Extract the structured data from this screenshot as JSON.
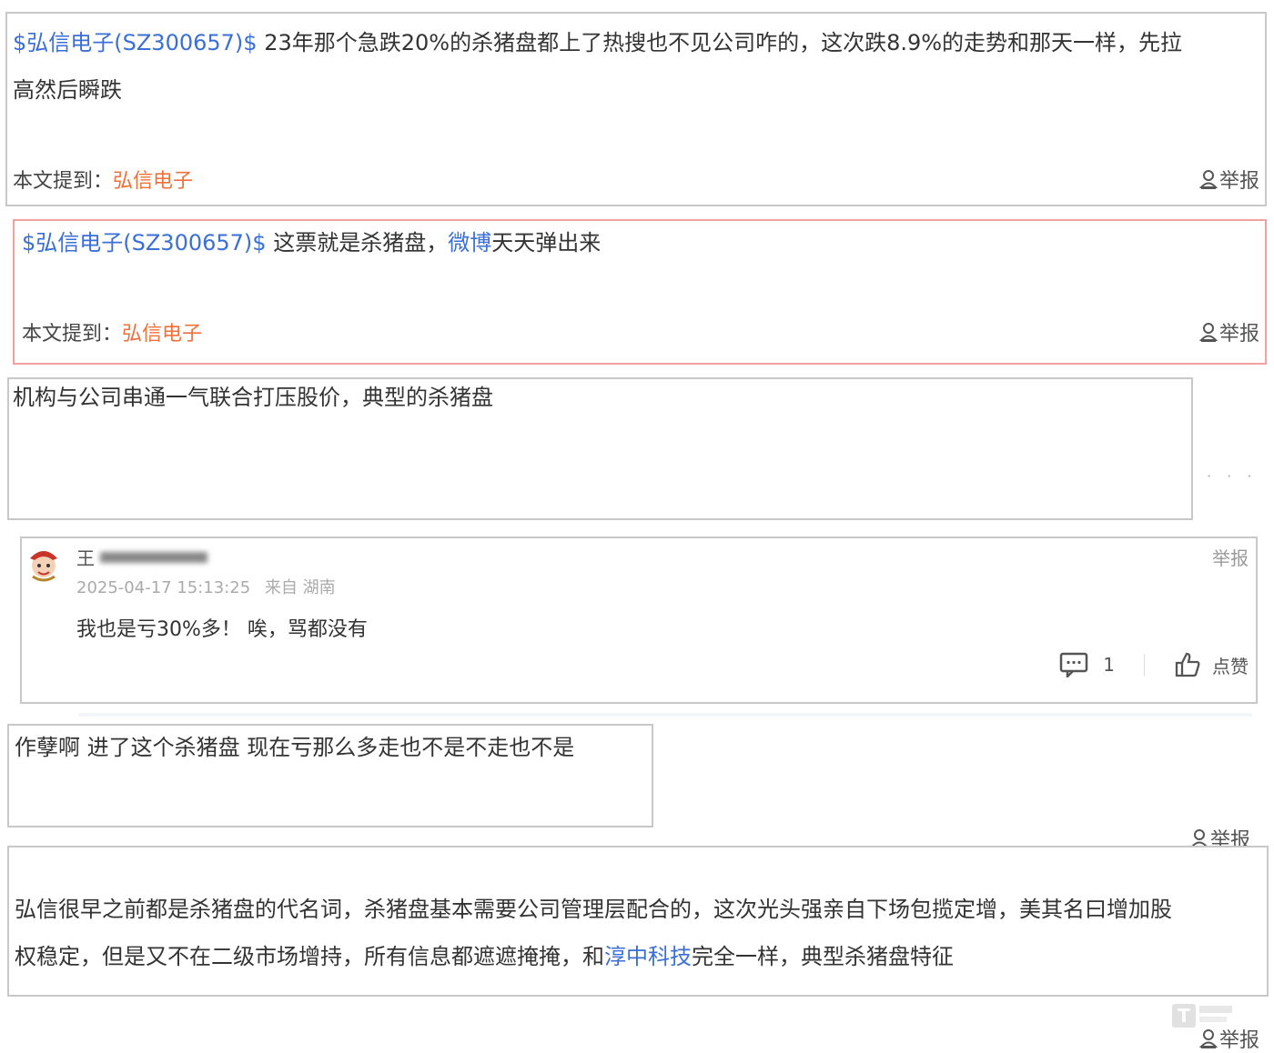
{
  "posts": [
    {
      "stock_tag": "$弘信电子(SZ300657)$",
      "text_line1": " 23年那个急跌20%的杀猪盘都上了热搜也不见公司咋的，这次跌8.9%的走势和那天一样，先拉",
      "text_line2": "高然后瞬跌",
      "mention_label": "本文提到：",
      "mention_stock": "弘信电子",
      "report_label": "举报"
    },
    {
      "stock_tag": "$弘信电子(SZ300657)$",
      "text_a": " 这票就是杀猪盘，",
      "text_link": "微博",
      "text_b": "天天弹出来",
      "mention_label": "本文提到：",
      "mention_stock": "弘信电子",
      "report_label": "举报"
    },
    {
      "text": "机构与公司串通一气联合打压股价，典型的杀猪盘"
    },
    {
      "user_name": "王",
      "timestamp": "2025-04-17 15:13:25",
      "location": "来自 湖南",
      "text": "我也是亏30%多！ 唉，骂都没有",
      "comment_count": "1",
      "like_label": "点赞",
      "report_label": "举报"
    },
    {
      "text": "作孽啊  进了这个杀猪盘  现在亏那么多走也不是不走也不是",
      "report_label": "举报"
    },
    {
      "text_line1": "弘信很早之前都是杀猪盘的代名词，杀猪盘基本需要公司管理层配合的，这次光头强亲自下场包揽定增，美其名曰增加股",
      "text_line2_a": "权稳定，但是又不在二级市场增持，所有信息都遮遮掩掩，和",
      "text_link": "淳中科技",
      "text_line2_b": "完全一样，典型杀猪盘特征",
      "report_label": "举报"
    }
  ],
  "icons": [
    "person-report-icon",
    "avatar-icon",
    "comment-icon",
    "thumbs-up-icon",
    "watermark-logo"
  ],
  "colors": {
    "stock_blue": "#3b6fd8",
    "mention_orange": "#f0703a",
    "red_border": "#f2a0a0"
  }
}
